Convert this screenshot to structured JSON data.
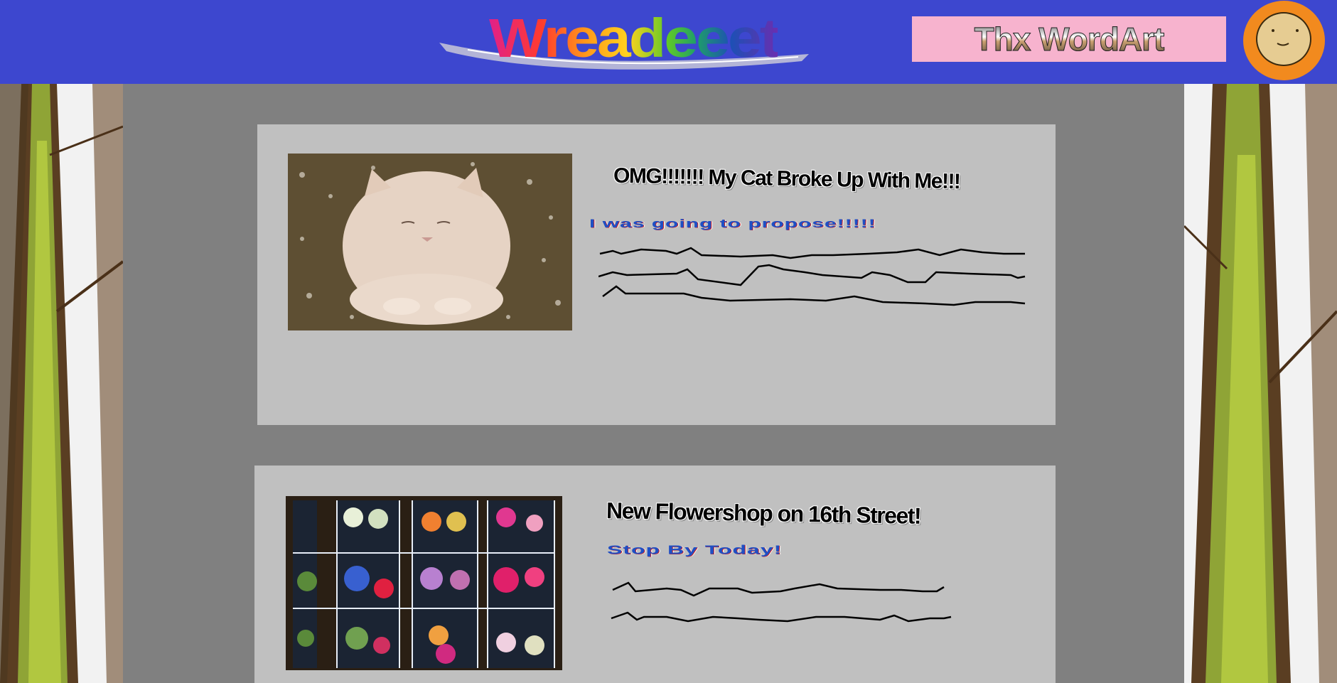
{
  "header": {
    "logo_text": "Wreadeeet",
    "banner_text": "Thx WordArt"
  },
  "posts": [
    {
      "title": "OMG!!!!!!! My Cat Broke Up With Me!!!",
      "subtitle": "I was going to propose!!!!!",
      "image_subject": "cat"
    },
    {
      "title": "New Flowershop on 16th Street!",
      "subtitle": "Stop By Today!",
      "image_subject": "flower-shop"
    }
  ],
  "colors": {
    "header_bg": "#3d47cf",
    "page_bg": "#808080",
    "card_bg": "#c0c0c0",
    "banner_bg": "#f7b3ce",
    "avatar_bg": "#f28a1e",
    "subtitle_blue": "#1f4fc4"
  },
  "icons": {
    "avatar": "smiley-face-icon"
  }
}
